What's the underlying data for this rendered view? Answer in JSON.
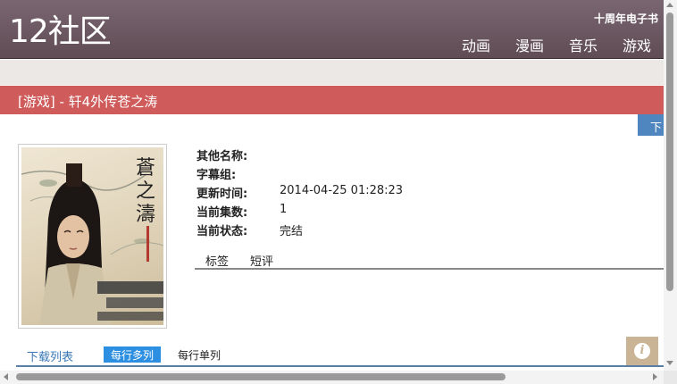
{
  "header": {
    "logo": "12社区",
    "anniversary": "十周年电子书",
    "nav": [
      "动画",
      "漫画",
      "音乐",
      "游戏"
    ]
  },
  "title": {
    "text": "[游戏] - 轩4外传苍之涛"
  },
  "download_tab": "下",
  "cover": {
    "title_art": "蒼之濤"
  },
  "info": {
    "rows": [
      {
        "label": "其他名称:",
        "value": ""
      },
      {
        "label": "字幕组:",
        "value": ""
      },
      {
        "label": "更新时间:",
        "value": "2014-04-25 01:28:23"
      },
      {
        "label": "当前集数:",
        "value": "1"
      },
      {
        "label": "当前状态:",
        "value": "完结"
      }
    ]
  },
  "tabs": [
    "标签",
    "短评"
  ],
  "download_list": {
    "title": "下载列表",
    "option_multi": "每行多列",
    "option_single": "每行单列"
  },
  "colors": {
    "header": "#6b5760",
    "title_bar": "#cf5b5b",
    "accent_blue": "#2d8fe2"
  }
}
